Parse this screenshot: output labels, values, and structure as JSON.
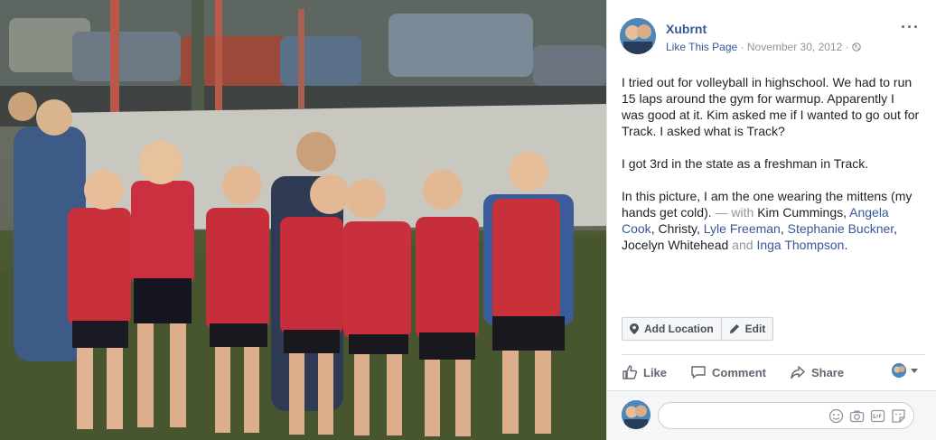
{
  "post": {
    "author": "Xubrnt",
    "like_page": "Like This Page",
    "separator": "·",
    "date": "November 30, 2012",
    "more_label": "···"
  },
  "caption": {
    "p1": "I tried out for volleyball in highschool. We had to run 15 laps around the gym for warmup. Apparently I was good at it. Kim asked me if I wanted to go out for Track. I asked what is Track?",
    "p2": "I got 3rd in the state as a freshman in Track.",
    "p3_text": "In this picture, I am the one wearing the mittens (my hands get cold).",
    "with_prefix": " — with ",
    "plain1": "Kim Cummings",
    "comma1": ", ",
    "tag1": "Angela Cook",
    "plain2": ", Christy, ",
    "tag2": "Lyle Freeman",
    "comma2": ", ",
    "tag3": "Stephanie Buckner",
    "plain3": ", Jocelyn Whitehead",
    "and_text": " and ",
    "tag4": "Inga Thompson",
    "end": "."
  },
  "actions": {
    "add_location": "Add Location",
    "edit": "Edit"
  },
  "reactions": {
    "like": "Like",
    "comment": "Comment",
    "share": "Share"
  },
  "colors": {
    "link": "#365899",
    "muted": "#90949c",
    "text": "#1d2129"
  },
  "icons": [
    "more-icon",
    "globe-icon",
    "location-pin-icon",
    "pencil-icon",
    "like-icon",
    "comment-icon",
    "share-icon",
    "emoji-icon",
    "camera-icon",
    "gif-icon",
    "sticker-icon"
  ]
}
